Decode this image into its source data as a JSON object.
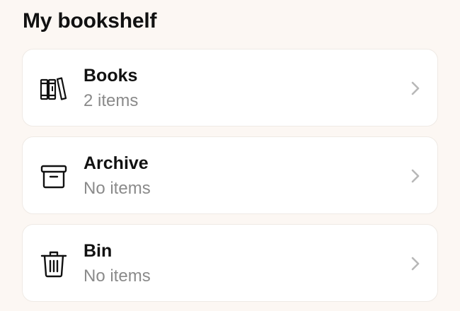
{
  "page": {
    "title": "My bookshelf",
    "background_color": "#fcf7f3"
  },
  "shelves": [
    {
      "title": "Books",
      "subtitle": "2 items",
      "icon": "books-icon"
    },
    {
      "title": "Archive",
      "subtitle": "No items",
      "icon": "archive-box-icon"
    },
    {
      "title": "Bin",
      "subtitle": "No items",
      "icon": "trash-bin-icon"
    }
  ],
  "colors": {
    "card_background": "#ffffff",
    "subtitle_text": "#8a8a8a",
    "chevron": "#b8b8b8"
  }
}
